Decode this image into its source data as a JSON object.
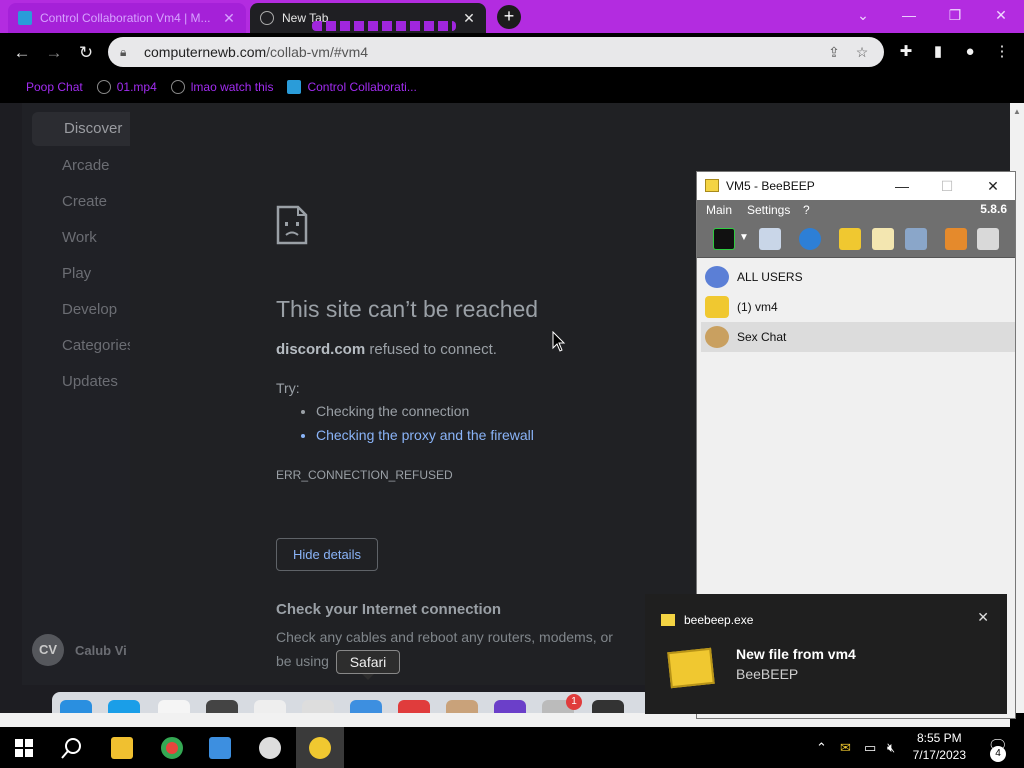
{
  "browser": {
    "tabs": [
      {
        "label": "Control Collaboration Vm4 | M...",
        "state": "active"
      },
      {
        "label": "New Tab",
        "state": "inactive"
      }
    ],
    "url_host": "computernewb.com",
    "url_path": "/collab-vm/#vm4",
    "bookmarks": [
      "Poop Chat",
      "01.mp4",
      "lmao watch this",
      "Control Collaborati..."
    ],
    "accent_color": "#b32ce0"
  },
  "page": {
    "sidebar": {
      "items": [
        "Discover",
        "Arcade",
        "Create",
        "Work",
        "Play",
        "Develop",
        "Categories",
        "Updates"
      ],
      "avatar_initials": "CV",
      "user_name": "Calub Vi"
    },
    "error": {
      "title": "This site can’t be reached",
      "domain": "discord.com",
      "desc_suffix": " refused to connect.",
      "try_label": "Try:",
      "suggestions": [
        "Checking the connection",
        "Checking the proxy and the firewall"
      ],
      "code": "ERR_CONNECTION_REFUSED",
      "hide_details_label": "Hide details",
      "check_title": "Check your Internet connection",
      "check_text": "Check any cables and reboot any routers, modems, or",
      "check_text_2": "be using"
    },
    "dock_tooltip": "Safari",
    "dock_badge": "1"
  },
  "beebeep": {
    "title": "VM5 - BeeBEEP",
    "menu": [
      "Main",
      "Settings",
      "?"
    ],
    "version": "5.8.6",
    "list": [
      {
        "label": "ALL USERS",
        "icon": "network-icon"
      },
      {
        "label": "(1) vm4",
        "icon": "envelope-icon"
      },
      {
        "label": "Sex Chat",
        "icon": "group-icon"
      }
    ]
  },
  "toast": {
    "app": "beebeep.exe",
    "heading": "New file from vm4",
    "body": "BeeBEEP"
  },
  "taskbar": {
    "time": "8:55 PM",
    "date": "7/17/2023",
    "notification_count": "4"
  }
}
